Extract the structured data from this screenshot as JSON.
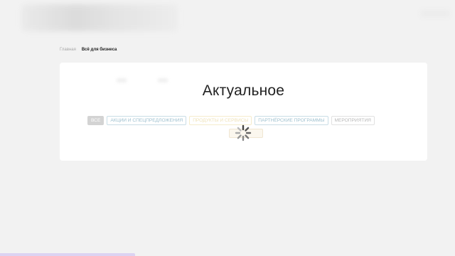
{
  "breadcrumb": {
    "home": "Главная",
    "current": "Всё для бизнеса"
  },
  "main": {
    "title": "Актуальное",
    "filters": [
      {
        "label": "Все",
        "active": true
      },
      {
        "label": "Акции и спецпредложения",
        "active": false
      },
      {
        "label": "Продукты и сервисы",
        "active": false
      },
      {
        "label": "Партнёрские программы",
        "active": false
      },
      {
        "label": "Мероприятия",
        "active": false
      }
    ]
  },
  "colors": {
    "background": "#f2f2f2",
    "card": "#ffffff",
    "chip_border": "#c9dde6",
    "chip_text": "#9ec0cf",
    "active_chip": "#d3d3d3",
    "bottom_bar": "#dcd3f2"
  },
  "icons": {
    "loading": "spinner-icon"
  }
}
